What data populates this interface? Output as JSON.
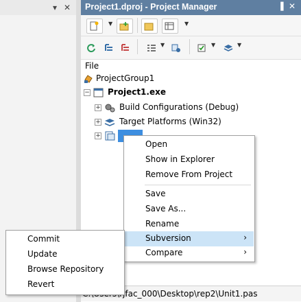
{
  "left_panel": {
    "pin_icon": "pin-icon",
    "close_icon": "close-icon"
  },
  "project_manager": {
    "title": "Project1.dproj - Project Manager",
    "file_label": "File",
    "tree": {
      "group": "ProjectGroup1",
      "project": "Project1.exe",
      "build_configurations": "Build Configurations (Debug)",
      "target_platforms": "Target Platforms (Win32)",
      "selected_unit": ""
    },
    "status_path": "C:\\Users\\rjfac_000\\Desktop\\rep2\\Unit1.pas"
  },
  "context_menu": {
    "items": [
      {
        "label": "Open"
      },
      {
        "label": "Show in Explorer"
      },
      {
        "label": "Remove From Project"
      },
      {
        "label": "Save"
      },
      {
        "label": "Save As..."
      },
      {
        "label": "Rename"
      },
      {
        "label": "Subversion",
        "has_submenu": true,
        "highlighted": true
      },
      {
        "label": "Compare",
        "has_submenu": true
      }
    ]
  },
  "subversion_menu": {
    "items": [
      {
        "label": "Commit"
      },
      {
        "label": "Update"
      },
      {
        "label": "Browse Repository"
      },
      {
        "label": "Revert"
      }
    ]
  },
  "colors": {
    "title_bar": "#5f7fa1",
    "highlight": "#cce4f7",
    "selection": "#3d8ee0"
  }
}
